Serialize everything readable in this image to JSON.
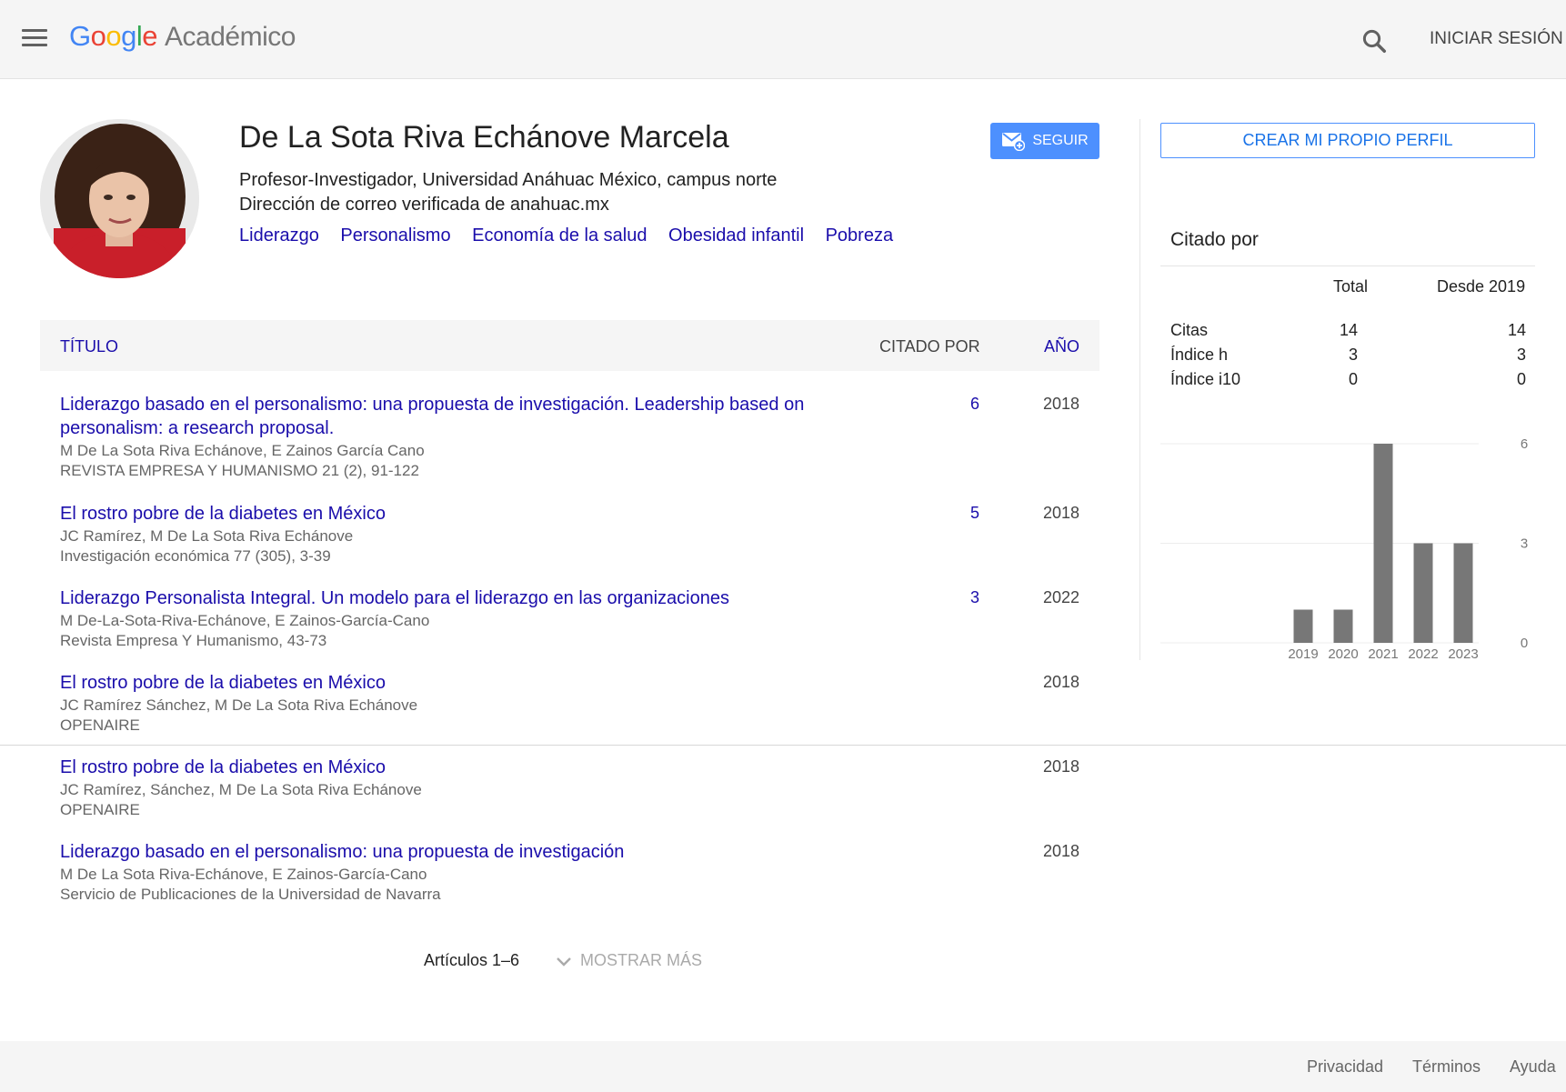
{
  "header": {
    "logo_letters": [
      "G",
      "o",
      "o",
      "g",
      "l",
      "e"
    ],
    "product": "Académico",
    "signin_label": "INICIAR SESIÓN"
  },
  "profile": {
    "name": "De La Sota Riva Echánove Marcela",
    "affiliation": "Profesor-Investigador, Universidad Anáhuac México, campus norte",
    "email": "Dirección de correo verificada de anahuac.mx",
    "interests": [
      "Liderazgo",
      "Personalismo",
      "Economía de la salud",
      "Obesidad infantil",
      "Pobreza"
    ],
    "follow_label": "SEGUIR"
  },
  "table": {
    "headers": {
      "title": "TÍTULO",
      "cited_by": "CITADO POR",
      "year": "AÑO"
    },
    "rows": [
      {
        "title": "Liderazgo basado en el personalismo: una propuesta de investigación. Leadership based on personalism: a research proposal.",
        "authors": "M De La Sota Riva Echánove, E Zainos García Cano",
        "venue": "REVISTA EMPRESA Y HUMANISMO 21 (2), 91-122",
        "cited": "6",
        "year": "2018"
      },
      {
        "title": "El rostro pobre de la diabetes en México",
        "authors": "JC Ramírez, M De La Sota Riva Echánove",
        "venue": "Investigación económica 77 (305), 3-39",
        "cited": "5",
        "year": "2018"
      },
      {
        "title": "Liderazgo Personalista Integral. Un modelo para el liderazgo en las organizaciones",
        "authors": "M De-La-Sota-Riva-Echánove, E Zainos-García-Cano",
        "venue": "Revista Empresa Y Humanismo, 43-73",
        "cited": "3",
        "year": "2022"
      },
      {
        "title": "El rostro pobre de la diabetes en México",
        "authors": "JC Ramírez Sánchez, M De La Sota Riva Echánove",
        "venue": "OPENAIRE",
        "cited": "",
        "year": "2018"
      },
      {
        "title": "El rostro pobre de la diabetes en México",
        "authors": "JC Ramírez, Sánchez, M De La Sota Riva Echánove",
        "venue": "OPENAIRE",
        "cited": "",
        "year": "2018"
      },
      {
        "title": "Liderazgo basado en el personalismo: una propuesta de investigación",
        "authors": "M De La Sota Riva-Echánove, E Zainos-García-Cano",
        "venue": "Servicio de Publicaciones de la Universidad de Navarra",
        "cited": "",
        "year": "2018"
      }
    ],
    "pager_count": "Artículos 1–6",
    "show_more_label": "MOSTRAR MÁS"
  },
  "sidebar": {
    "create_profile_label": "CREAR MI PROPIO PERFIL",
    "cited_by_title": "Citado por",
    "col_total": "Total",
    "col_since": "Desde 2019",
    "stats": [
      {
        "label": "Citas",
        "total": "14",
        "since": "14"
      },
      {
        "label": "Índice h",
        "total": "3",
        "since": "3"
      },
      {
        "label": "Índice i10",
        "total": "0",
        "since": "0"
      }
    ]
  },
  "chart_data": {
    "type": "bar",
    "categories": [
      "2019",
      "2020",
      "2021",
      "2022",
      "2023"
    ],
    "values": [
      1,
      1,
      6,
      3,
      3
    ],
    "ylim": [
      0,
      6
    ],
    "yticks": [
      0,
      3,
      6
    ],
    "grid": true,
    "bar_color": "#777777"
  },
  "footer": {
    "links": [
      "Privacidad",
      "Términos",
      "Ayuda"
    ]
  },
  "colors": {
    "link": "#1a0dab",
    "button_blue": "#4d90fe",
    "header_bg": "#f5f5f5"
  }
}
